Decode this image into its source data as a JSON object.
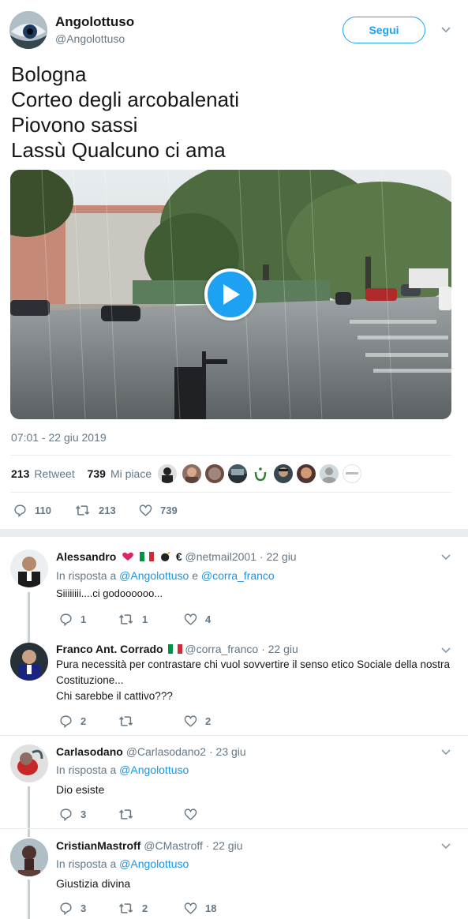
{
  "tweet": {
    "author_name": "Angolottuso",
    "author_handle": "@Angolottuso",
    "follow_label": "Segui",
    "lines": [
      "Bologna",
      "Corteo degli arcobalenati",
      "Piovono sassi",
      "Lassù Qualcuno ci ama"
    ],
    "timestamp": "07:01 - 22 giu 2019",
    "retweets_count": "213",
    "retweets_label": "Retweet",
    "likes_count": "739",
    "likes_label": "Mi piace",
    "reply_count": "110",
    "retweet_action_count": "213",
    "like_action_count": "739"
  },
  "replies": [
    {
      "name": "Alessandro",
      "name_suffix": "€",
      "handle": "@netmail2001",
      "date": "· 22 giu",
      "in_reply_prefix": "In risposta a",
      "in_reply_user1": "@Angolottuso",
      "in_reply_joiner": "e",
      "in_reply_user2": "@corra_franco",
      "text": "Siiiiiiii....ci godoooooo...",
      "replies": "1",
      "retweets": "1",
      "likes": "4"
    },
    {
      "name": "Franco Ant. Corrado",
      "handle": "@corra_franco",
      "date": "· 22 giu",
      "text_line1": "Pura necessità per contrastare chi vuol sovvertire il senso etico Sociale della nostra",
      "text_line2": "Costituzione...",
      "text_line3": "Chi sarebbe il cattivo???",
      "replies": "2",
      "retweets": "",
      "likes": "2"
    },
    {
      "name": "Carlasodano",
      "handle": "@Carlasodano2",
      "date": "· 23 giu",
      "in_reply_prefix": "In risposta a",
      "in_reply_user1": "@Angolottuso",
      "text": "Dio esiste",
      "replies": "3",
      "retweets": "",
      "likes": ""
    },
    {
      "name": "CristianMastroff",
      "handle": "@CMastroff",
      "date": "· 22 giu",
      "in_reply_prefix": "In risposta a",
      "in_reply_user1": "@Angolottuso",
      "text": "Giustizia divina",
      "replies": "3",
      "retweets": "2",
      "likes": "18"
    }
  ],
  "colors": {
    "accent": "#1da1f2",
    "link": "#1b95e0",
    "muted": "#657786",
    "divider": "#e6ecf0"
  },
  "icons": [
    "eye-avatar-icon",
    "chevron-down-icon",
    "play-icon",
    "reply-icon",
    "retweet-icon",
    "heart-icon",
    "italy-flag-icon",
    "bomb-icon",
    "red-heart-icon"
  ]
}
